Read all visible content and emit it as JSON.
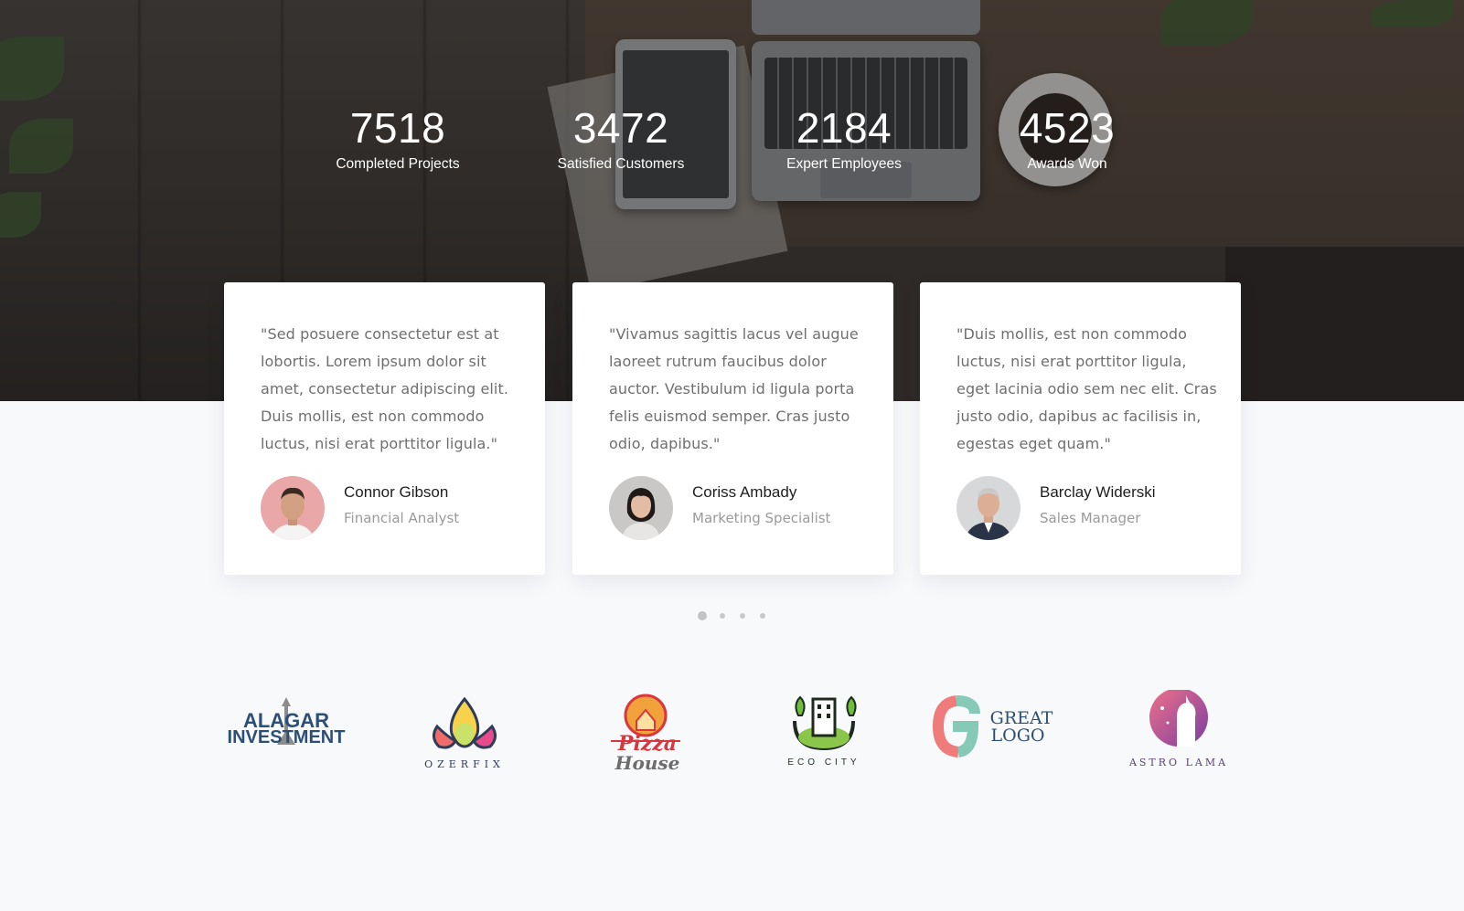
{
  "stats": [
    {
      "value": "7518",
      "label": "Completed Projects"
    },
    {
      "value": "3472",
      "label": "Satisfied Customers"
    },
    {
      "value": "2184",
      "label": "Expert Employees"
    },
    {
      "value": "4523",
      "label": "Awards Won"
    }
  ],
  "testimonials": [
    {
      "quote": "\"Sed posuere consectetur est at lobortis. Lorem ipsum dolor sit amet, consectetur adipiscing elit. Duis mollis, est non commodo luctus, nisi erat porttitor ligula.\"",
      "name": "Connor Gibson",
      "role": "Financial Analyst"
    },
    {
      "quote": "\"Vivamus sagittis lacus vel augue laoreet rutrum faucibus dolor auctor. Vestibulum id ligula porta felis euismod semper. Cras justo odio, dapibus.\"",
      "name": "Coriss Ambady",
      "role": "Marketing Specialist"
    },
    {
      "quote": "\"Duis mollis, est non commodo luctus, nisi erat porttitor ligula, eget lacinia odio sem nec elit. Cras justo odio, dapibus ac facilisis in, egestas eget quam.\"",
      "name": "Barclay Widerski",
      "role": "Sales Manager"
    }
  ],
  "carousel": {
    "page_count": 4,
    "active_index": 0
  },
  "logos": {
    "alagar_line1": "ALAGAR",
    "alagar_line2": "INVESTMENT",
    "ozerfix": "OZERFIX",
    "pizza_line1": "Pizza",
    "pizza_line2": "House",
    "ecocity": "ECO CITY",
    "great_line1": "GREAT",
    "great_line2": "LOGO",
    "astrolama": "ASTRO LAMA"
  },
  "colors": {
    "page_bg": "#f8f9fb",
    "card_bg": "#ffffff",
    "quote_text": "#6f6f6f",
    "name_text": "#1e1e1e",
    "role_text": "#9a9a9a"
  }
}
